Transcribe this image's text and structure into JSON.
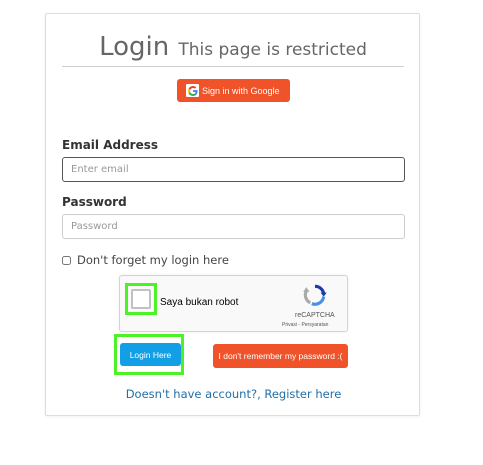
{
  "header": {
    "title": "Login",
    "subtitle": "This page is restricted"
  },
  "google_button": {
    "label": "Sign in with Google",
    "icon": "google-icon"
  },
  "form": {
    "email_label": "Email Address",
    "email_placeholder": "Enter email",
    "password_label": "Password",
    "password_placeholder": "Password",
    "remember_label": "Don't forget my login here"
  },
  "captcha": {
    "checkbox_label": "Saya bukan robot",
    "brand": "reCAPTCHA",
    "terms": "Privasi - Persyaratan",
    "icon": "recaptcha-icon"
  },
  "buttons": {
    "login": "Login Here",
    "forgot": "I don't remember my password :("
  },
  "register_link": "Doesn't have account?, Register here",
  "colors": {
    "google_button": "#f0522a",
    "login_button": "#139fe6",
    "forgot_button": "#f0522a",
    "highlight": "#4cf126",
    "link": "#1f6fa8"
  }
}
